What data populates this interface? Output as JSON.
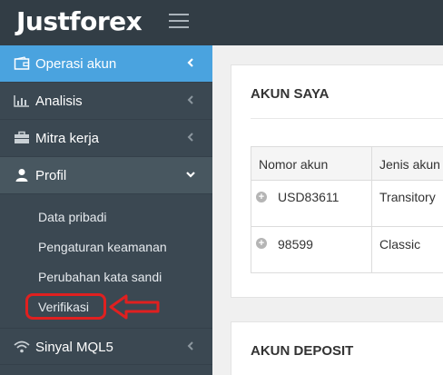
{
  "app": {
    "logo_text": "Justforex"
  },
  "sidebar": {
    "items": [
      {
        "label": "Operasi akun",
        "icon": "wallet-icon"
      },
      {
        "label": "Analisis",
        "icon": "bar-chart-icon"
      },
      {
        "label": "Mitra kerja",
        "icon": "briefcase-icon"
      },
      {
        "label": "Profil",
        "icon": "user-icon"
      },
      {
        "label": "Sinyal MQL5",
        "icon": "wifi-icon"
      }
    ],
    "submenu": [
      {
        "label": "Data pribadi"
      },
      {
        "label": "Pengaturan keamanan"
      },
      {
        "label": "Perubahan kata sandi"
      },
      {
        "label": "Verifikasi"
      }
    ]
  },
  "main": {
    "accounts_panel": {
      "title": "AKUN SAYA",
      "columns": [
        "Nomor akun",
        "Jenis akun"
      ],
      "rows": [
        {
          "number": "USD83611",
          "type": "Transitory"
        },
        {
          "number": "98599",
          "type": "Classic"
        }
      ]
    },
    "deposit_panel": {
      "title": "AKUN DEPOSIT"
    }
  },
  "colors": {
    "topbar": "#323d45",
    "sidebar": "#3b4852",
    "active": "#4aa3df",
    "annotation": "#e02020"
  }
}
